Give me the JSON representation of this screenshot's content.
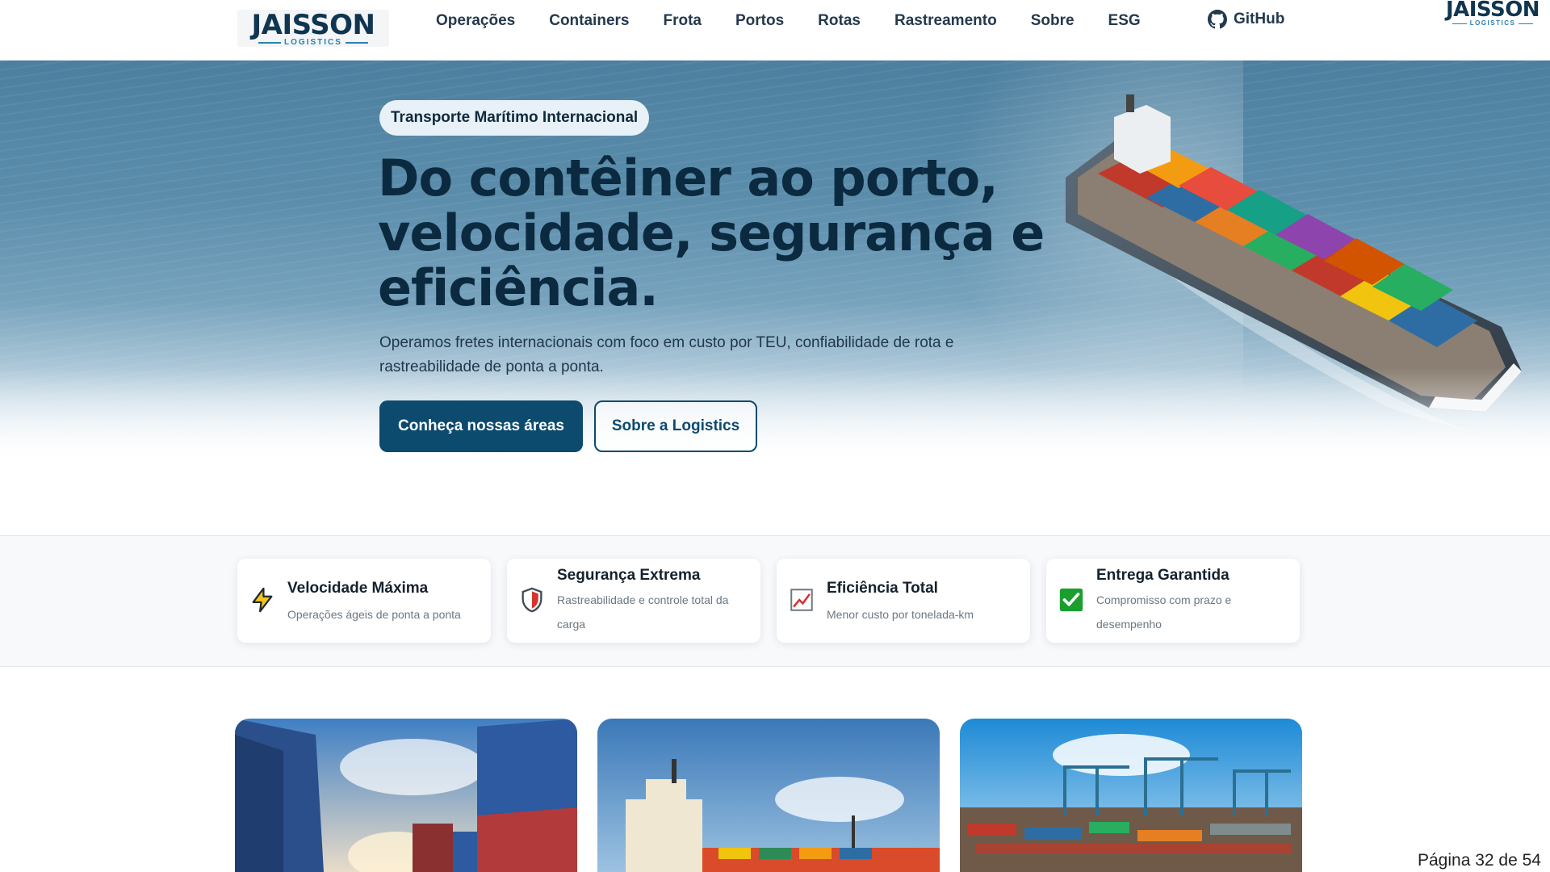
{
  "header": {
    "logo": {
      "word": "JAISSON",
      "sub": "LOGISTICS"
    },
    "nav": [
      "Operações",
      "Containers",
      "Frota",
      "Portos",
      "Rotas",
      "Rastreamento",
      "Sobre",
      "ESG"
    ],
    "github_label": "GitHub",
    "corner_logo": {
      "word": "JAISSON",
      "sub": "LOGISTICS"
    }
  },
  "hero": {
    "badge": "Transporte Marítimo Internacional",
    "headline": "Do contêiner ao porto, velocidade, segurança e eficiência.",
    "lede": "Operamos fretes internacionais com foco em custo por TEU, confiabilidade de rota e rastreabilidade de ponta a ponta.",
    "primary_cta": "Conheça nossas áreas",
    "secondary_cta": "Sobre a Logistics"
  },
  "features": [
    {
      "icon": "lightning-icon",
      "title": "Velocidade Máxima",
      "desc": "Operações ágeis de ponta a ponta"
    },
    {
      "icon": "shield-icon",
      "title": "Segurança Extrema",
      "desc": "Rastreabilidade e controle total da carga"
    },
    {
      "icon": "chart-up-icon",
      "title": "Eficiência Total",
      "desc": "Menor custo por tonelada-km"
    },
    {
      "icon": "check-icon",
      "title": "Entrega Garantida",
      "desc": "Compromisso com prazo e desempenho"
    }
  ],
  "cards": [
    {
      "image": "container-stacks-image"
    },
    {
      "image": "container-ship-image"
    },
    {
      "image": "port-cranes-image"
    }
  ],
  "colors": {
    "primary": "#0c4a6e",
    "heading": "#0b2a40",
    "badge_bg": "#e8f1f7",
    "check_green": "#1a9e2e"
  },
  "footer": {
    "page_number": "Página 32 de 54"
  }
}
